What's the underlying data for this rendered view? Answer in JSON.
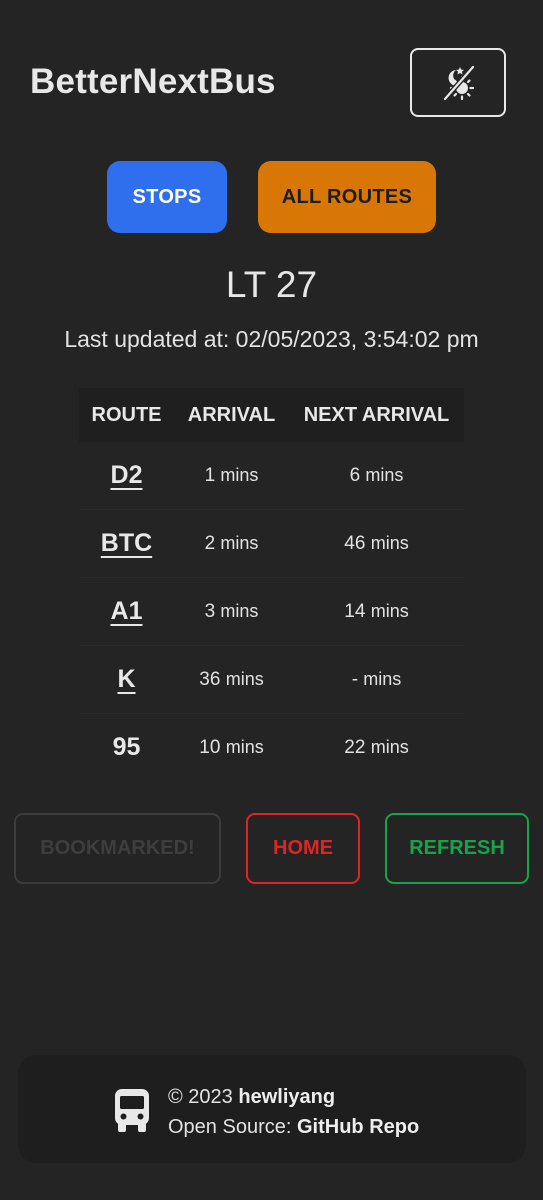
{
  "header": {
    "title": "BetterNextBus",
    "theme_toggle_icon": "theme-toggle-icon"
  },
  "nav": {
    "stops_label": "STOPS",
    "all_routes_label": "ALL ROUTES"
  },
  "stop": {
    "name": "LT 27",
    "last_updated": "Last updated at: 02/05/2023, 3:54:02 pm"
  },
  "table": {
    "headers": {
      "route": "ROUTE",
      "arrival": "ARRIVAL",
      "next_arrival": "NEXT ARRIVAL"
    },
    "rows": [
      {
        "route": "D2",
        "arrival": "1",
        "arrival_unit": "mins",
        "next": "6",
        "next_unit": "mins"
      },
      {
        "route": "BTC",
        "arrival": "2",
        "arrival_unit": "mins",
        "next": "46",
        "next_unit": "mins"
      },
      {
        "route": "A1",
        "arrival": "3",
        "arrival_unit": "mins",
        "next": "14",
        "next_unit": "mins"
      },
      {
        "route": "K",
        "arrival": "36",
        "arrival_unit": "mins",
        "next": "-",
        "next_unit": "mins"
      },
      {
        "route": "95",
        "arrival": "10",
        "arrival_unit": "mins",
        "next": "22",
        "next_unit": "mins"
      }
    ]
  },
  "actions": {
    "bookmark_label": "BOOKMARKED!",
    "home_label": "HOME",
    "refresh_label": "REFRESH"
  },
  "footer": {
    "copyright_prefix": "© 2023",
    "author": "hewliyang",
    "source_prefix": "Open Source:",
    "repo_link": "GitHub Repo",
    "icon": "bus-icon"
  },
  "colors": {
    "background": "#242424",
    "stops_button": "#2f6fed",
    "routes_button": "#d97706",
    "home": "#dc2626",
    "refresh": "#16a34a"
  }
}
